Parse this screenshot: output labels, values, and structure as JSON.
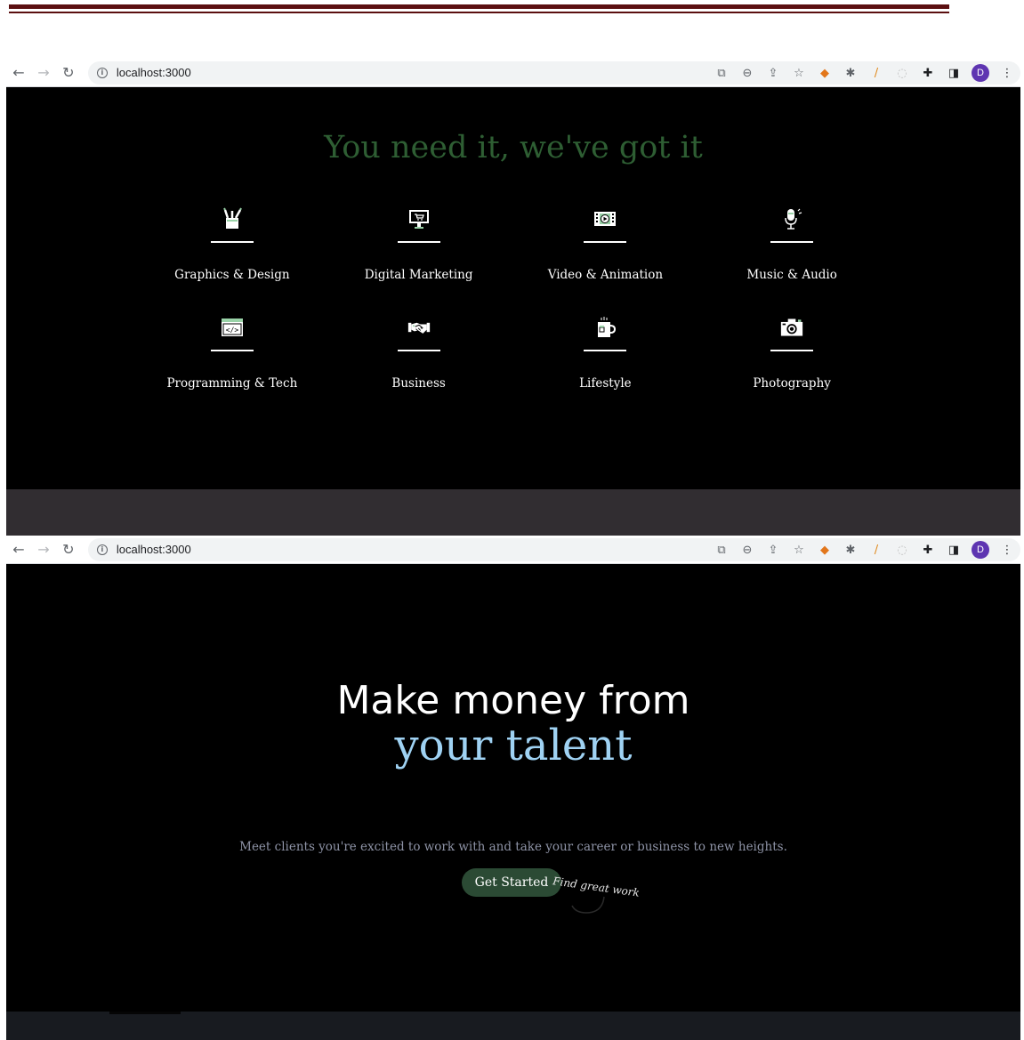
{
  "windows": [
    {
      "url": "localhost:3000",
      "profile_initial": "D"
    },
    {
      "url": "localhost:3000",
      "profile_initial": "D"
    }
  ],
  "categories_section": {
    "title": "You need it, we've got it",
    "categories": [
      {
        "label": "Graphics & Design",
        "icon": "pencil-cup-icon"
      },
      {
        "label": "Digital Marketing",
        "icon": "monitor-cart-icon"
      },
      {
        "label": "Video & Animation",
        "icon": "film-play-icon"
      },
      {
        "label": "Music & Audio",
        "icon": "microphone-icon"
      },
      {
        "label": "Programming & Tech",
        "icon": "code-window-icon"
      },
      {
        "label": "Business",
        "icon": "handshake-icon"
      },
      {
        "label": "Lifestyle",
        "icon": "coffee-mug-icon"
      },
      {
        "label": "Photography",
        "icon": "camera-icon"
      }
    ]
  },
  "hero": {
    "line1": "Make money from",
    "line2": "your talent",
    "subtitle": "Meet clients you're excited to work with and take your career or business to new heights.",
    "cta_label": "Get Started",
    "tagline": "Find great work"
  },
  "colors": {
    "title_green": "#2e5e33",
    "accent_blue": "#9fd2f3",
    "button_green": "#2b4a34"
  }
}
